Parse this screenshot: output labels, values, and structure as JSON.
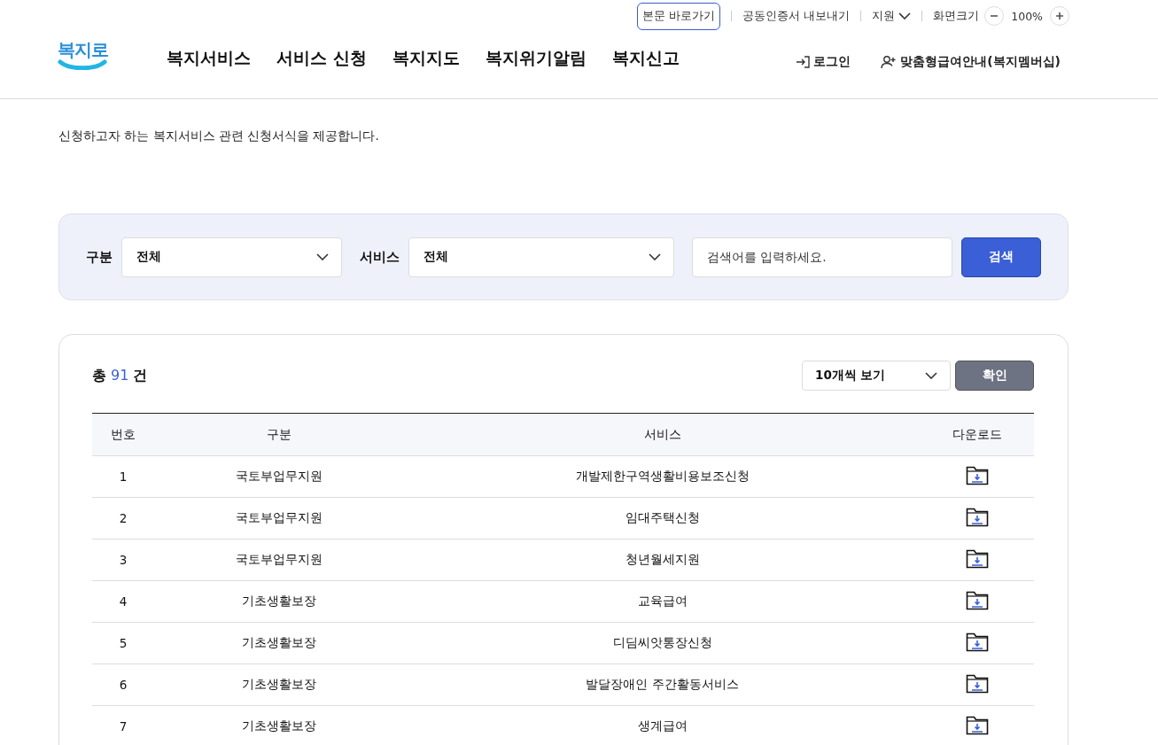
{
  "utility_bar": {
    "skip_link": "본문 바로가기",
    "items": [
      {
        "label": "공동인증서 내보내기",
        "kind": "link"
      },
      {
        "label": "지원",
        "kind": "dropdown"
      }
    ],
    "zoom": {
      "label": "화면크기",
      "value": "100%"
    }
  },
  "header": {
    "logo": "복지로",
    "nav": [
      "복지서비스",
      "서비스 신청",
      "복지지도",
      "복지위기알림",
      "복지신고"
    ],
    "actions": [
      {
        "label": "로그인",
        "kind": "login"
      },
      {
        "label": "맞춤형급여안내(복지멤버십)",
        "kind": "member"
      }
    ]
  },
  "page": {
    "description": "신청하고자 하는 복지서비스 관련 신청서식을 제공합니다."
  },
  "search": {
    "category_label": "구분",
    "category_value": "전체",
    "service_label": "서비스",
    "service_value": "전체",
    "placeholder": "검색어를 입력하세요.",
    "button": "검색"
  },
  "results": {
    "count_prefix": "총",
    "count": "91",
    "count_suffix": "건",
    "page_size": "10개씩 보기",
    "confirm": "확인"
  },
  "table": {
    "columns": [
      "번호",
      "구분",
      "서비스",
      "다운로드"
    ],
    "rows": [
      {
        "no": "1",
        "category": "국토부업무지원",
        "service": "개발제한구역생활비용보조신청"
      },
      {
        "no": "2",
        "category": "국토부업무지원",
        "service": "임대주택신청"
      },
      {
        "no": "3",
        "category": "국토부업무지원",
        "service": "청년월세지원"
      },
      {
        "no": "4",
        "category": "기초생활보장",
        "service": "교육급여"
      },
      {
        "no": "5",
        "category": "기초생활보장",
        "service": "디딤씨앗통장신청"
      },
      {
        "no": "6",
        "category": "기초생활보장",
        "service": "발달장애인 주간활동서비스"
      },
      {
        "no": "7",
        "category": "기초생활보장",
        "service": "생계급여"
      }
    ]
  }
}
